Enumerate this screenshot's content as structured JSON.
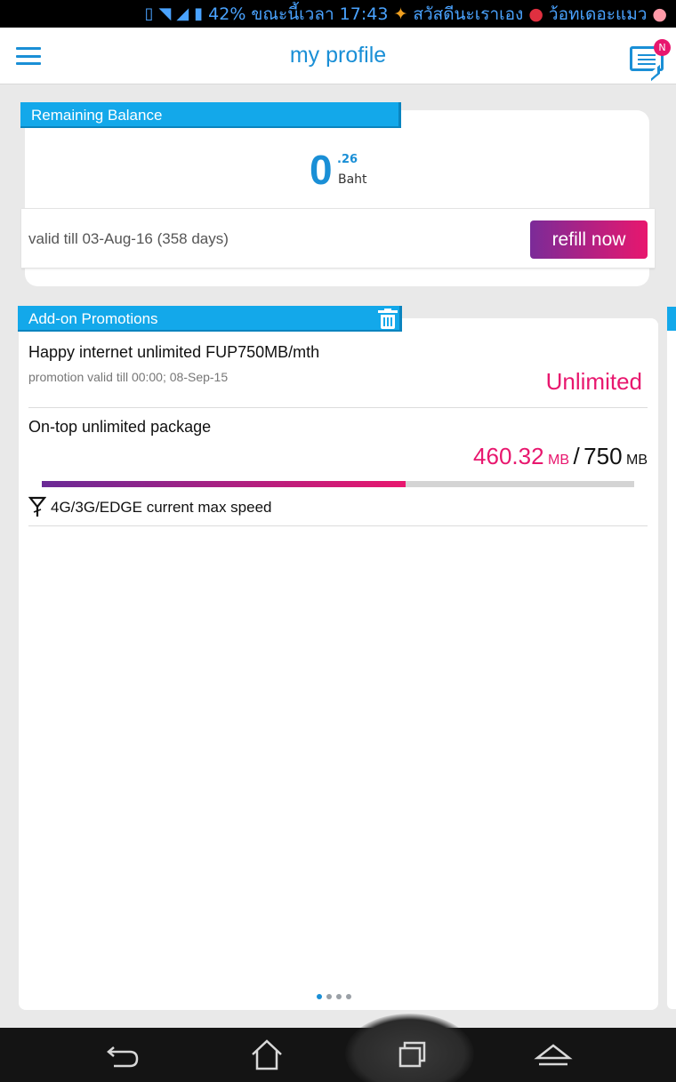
{
  "status_bar": {
    "battery": "42%",
    "thai_text_1": "ขณะนี้เวลา",
    "time": "17:43",
    "thai_text_2": "สวัสดีนะเราเอง",
    "thai_text_3": "ว้อทเดอะแมว"
  },
  "header": {
    "title": "my profile",
    "badge": "N"
  },
  "balance": {
    "ribbon_label": "Remaining Balance",
    "integer": "0",
    "decimal": ".26",
    "unit": "Baht",
    "valid_text": "valid till 03-Aug-16 (358 days)",
    "refill_label": "refill now"
  },
  "promotions": {
    "ribbon_label": "Add-on Promotions",
    "items": [
      {
        "name": "Happy internet unlimited FUP750MB/mth",
        "valid": "promotion valid till 00:00; 08-Sep-15",
        "status": "Unlimited"
      },
      {
        "name": "On-top unlimited package",
        "used": "460.32",
        "used_unit": "MB",
        "separator": "/",
        "total": "750",
        "total_unit": "MB",
        "progress": 0.6138,
        "speed_text": "4G/3G/EDGE current max speed"
      }
    ]
  },
  "pager": {
    "pages": 4,
    "active": 0
  },
  "colors": {
    "accent": "#1a8fd6",
    "ribbon": "#13a8ea",
    "magenta": "#e8176e",
    "purple": "#7b2b98"
  }
}
